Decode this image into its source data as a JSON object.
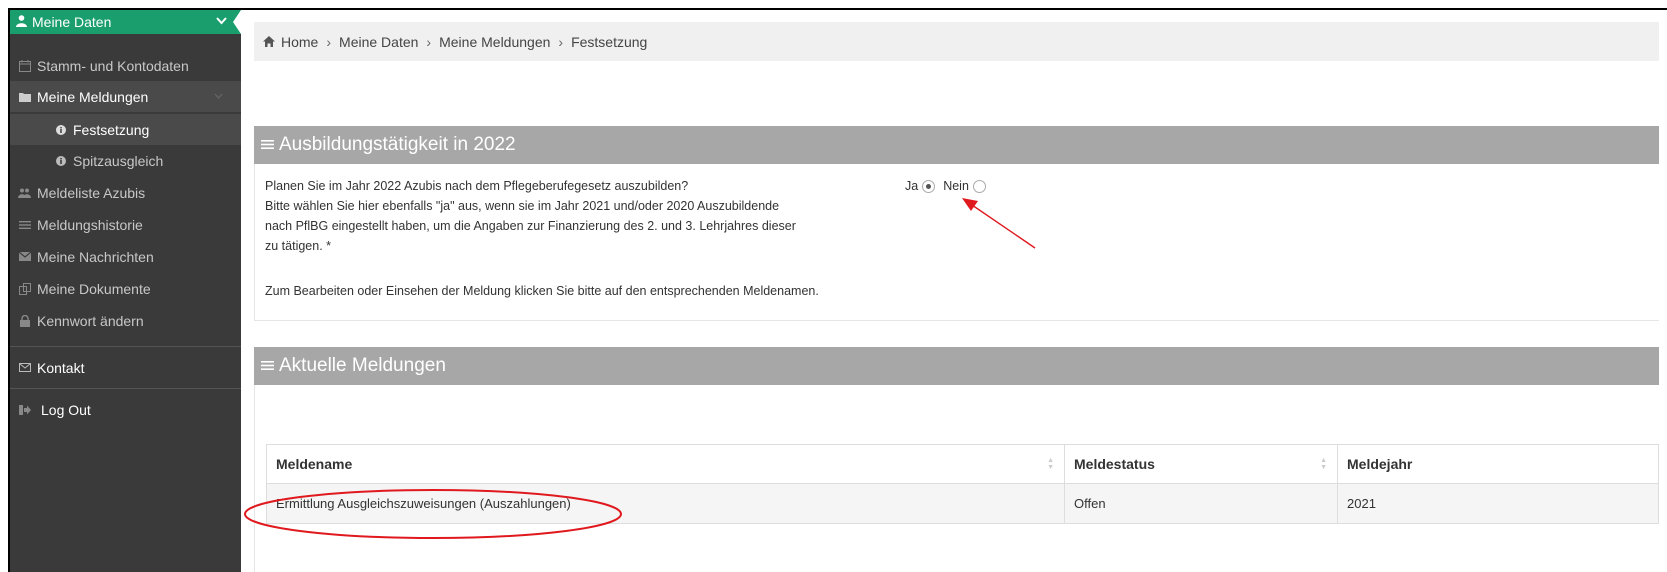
{
  "sidebar": {
    "header": {
      "label": "Meine Daten",
      "icon": "user-icon"
    },
    "items": [
      {
        "label": "Stamm- und Kontodaten",
        "icon": "calendar-icon"
      },
      {
        "label": "Meine Meldungen",
        "icon": "folder-icon"
      },
      {
        "label": "Festsetzung",
        "icon": "info-icon"
      },
      {
        "label": "Spitzausgleich",
        "icon": "info-icon"
      },
      {
        "label": "Meldeliste Azubis",
        "icon": "users-icon"
      },
      {
        "label": "Meldungshistorie",
        "icon": "list-icon"
      },
      {
        "label": "Meine Nachrichten",
        "icon": "envelope-icon"
      },
      {
        "label": "Meine Dokumente",
        "icon": "documents-icon"
      },
      {
        "label": "Kennwort ändern",
        "icon": "lock-icon"
      }
    ],
    "contact": {
      "label": "Kontakt",
      "icon": "envelope-outline-icon"
    },
    "logout": {
      "label": "Log Out",
      "icon": "sign-out-icon"
    }
  },
  "breadcrumb": {
    "home": "Home",
    "items": [
      "Meine Daten",
      "Meine Meldungen",
      "Festsetzung"
    ]
  },
  "ausbildung": {
    "title": "Ausbildungstätigkeit in 2022",
    "question_lines": [
      "Planen Sie im Jahr 2022 Azubis nach dem Pflegeberufegesetz auszubilden?",
      "Bitte wählen Sie hier ebenfalls \"ja\" aus, wenn sie im Jahr 2021 und/oder 2020 Auszubildende",
      "nach PflBG eingestellt haben, um die Angaben zur Finanzierung des 2. und 3. Lehrjahres dieser",
      "zu tätigen. *"
    ],
    "note": "Zum Bearbeiten oder Einsehen der Meldung klicken Sie bitte auf den entsprechenden Meldenamen.",
    "option_yes": "Ja",
    "option_no": "Nein",
    "selected": "Ja"
  },
  "meldungen": {
    "title": "Aktuelle Meldungen",
    "columns": [
      "Meldename",
      "Meldestatus",
      "Meldejahr"
    ],
    "rows": [
      [
        "Ermittlung Ausgleichszuweisungen (Auszahlungen)",
        "Offen",
        "2021"
      ]
    ]
  },
  "colors": {
    "sidebar_bg": "#3a3a3a",
    "sidebar_header": "#1a9e6e",
    "panel_header": "#a7a7a7",
    "annotation": "#e0191e"
  }
}
